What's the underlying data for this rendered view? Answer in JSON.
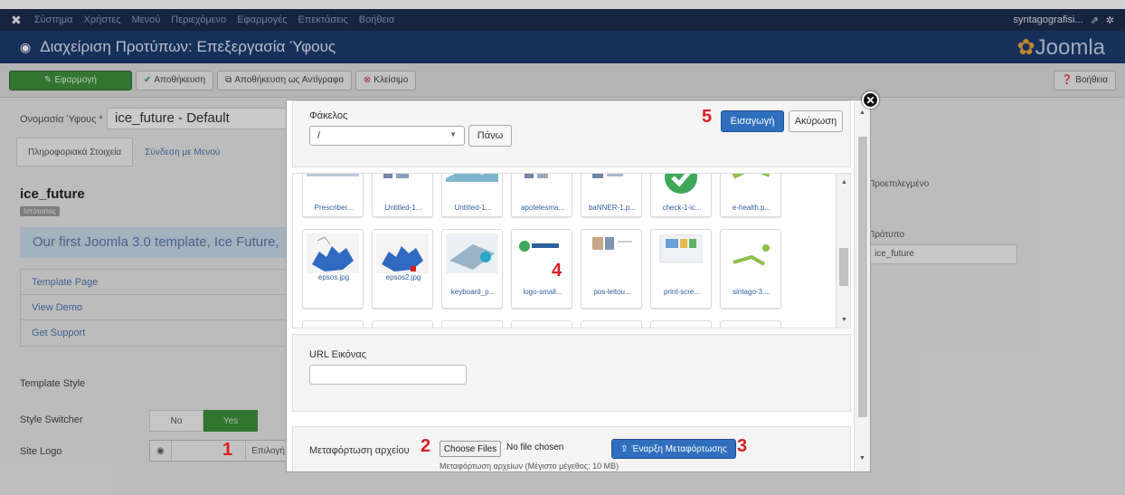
{
  "topnav": {
    "menu": [
      "Σύστημα",
      "Χρήστες",
      "Μενού",
      "Περιεχόμενο",
      "Εφαρμογές",
      "Επεκτάσεις",
      "Βοήθεια"
    ],
    "user": "syntagografisi..."
  },
  "header": {
    "title": "Διαχείριση Προτύπων: Επεξεργασία Ύφους",
    "brand": "Joomla"
  },
  "toolbar": {
    "apply": "Εφαρμογή",
    "save": "Αποθήκευση",
    "save_copy": "Αποθήκευση ως Αντίγραφο",
    "close": "Κλείσιμο",
    "help": "Βοήθεια"
  },
  "form": {
    "name_label": "Ονομασία Ύφους *",
    "name_value": "ice_future - Default",
    "tabs": [
      "Πληροφοριακά Στοιχεία",
      "Σύνδεση με Μενού"
    ],
    "template_name": "ice_future",
    "tag": "Ιστότοπος",
    "description": "Our first Joomla 3.0 template, Ice Future,",
    "links": [
      "Template Page",
      "View Demo",
      "Get Support"
    ],
    "template_style": "Template Style",
    "style_switcher": "Style Switcher",
    "no": "No",
    "yes": "Yes",
    "site_logo": "Site Logo",
    "select": "Επιλογή",
    "right_default": "Προεπιλεγμένο",
    "right_template": "Πρότυπο",
    "right_template_value": "ice_future"
  },
  "modal": {
    "folder_label": "Φάκελος",
    "folder_value": "/",
    "up_button": "Πάνω",
    "insert_button": "Εισαγωγή",
    "cancel_button": "Ακύρωση",
    "url_label": "URL Εικόνας",
    "upload_label": "Μεταφόρτωση αρχείου",
    "choose_files": "Choose Files",
    "no_file": "No file chosen",
    "start_upload": "Έναρξη Μεταφόρτωσης",
    "hint": "Μεταφόρτωση αρχείων (Μέγιστο μέγεθος: 10 MB)",
    "thumbs_row1": [
      "Prescriber...",
      "Untitled-1...",
      "Untitled-1...",
      "apotelesma...",
      "baNNER-1.p...",
      "check-1-ic...",
      "e-health.p..."
    ],
    "thumbs_row2": [
      "epsos.jpg",
      "epsos2.jpg",
      "keyboard_p...",
      "logo-small...",
      "pos-leitou...",
      "print-scre...",
      "sintago-3...."
    ]
  },
  "annotations": {
    "n1": "1",
    "n2": "2",
    "n3": "3",
    "n4": "4",
    "n5": "5"
  },
  "colors": {
    "nav": "#1b2d4d",
    "header": "#1d3b6e",
    "primary": "#2f6fbd",
    "success": "#3c8f3c",
    "annotation": "#d62020"
  }
}
